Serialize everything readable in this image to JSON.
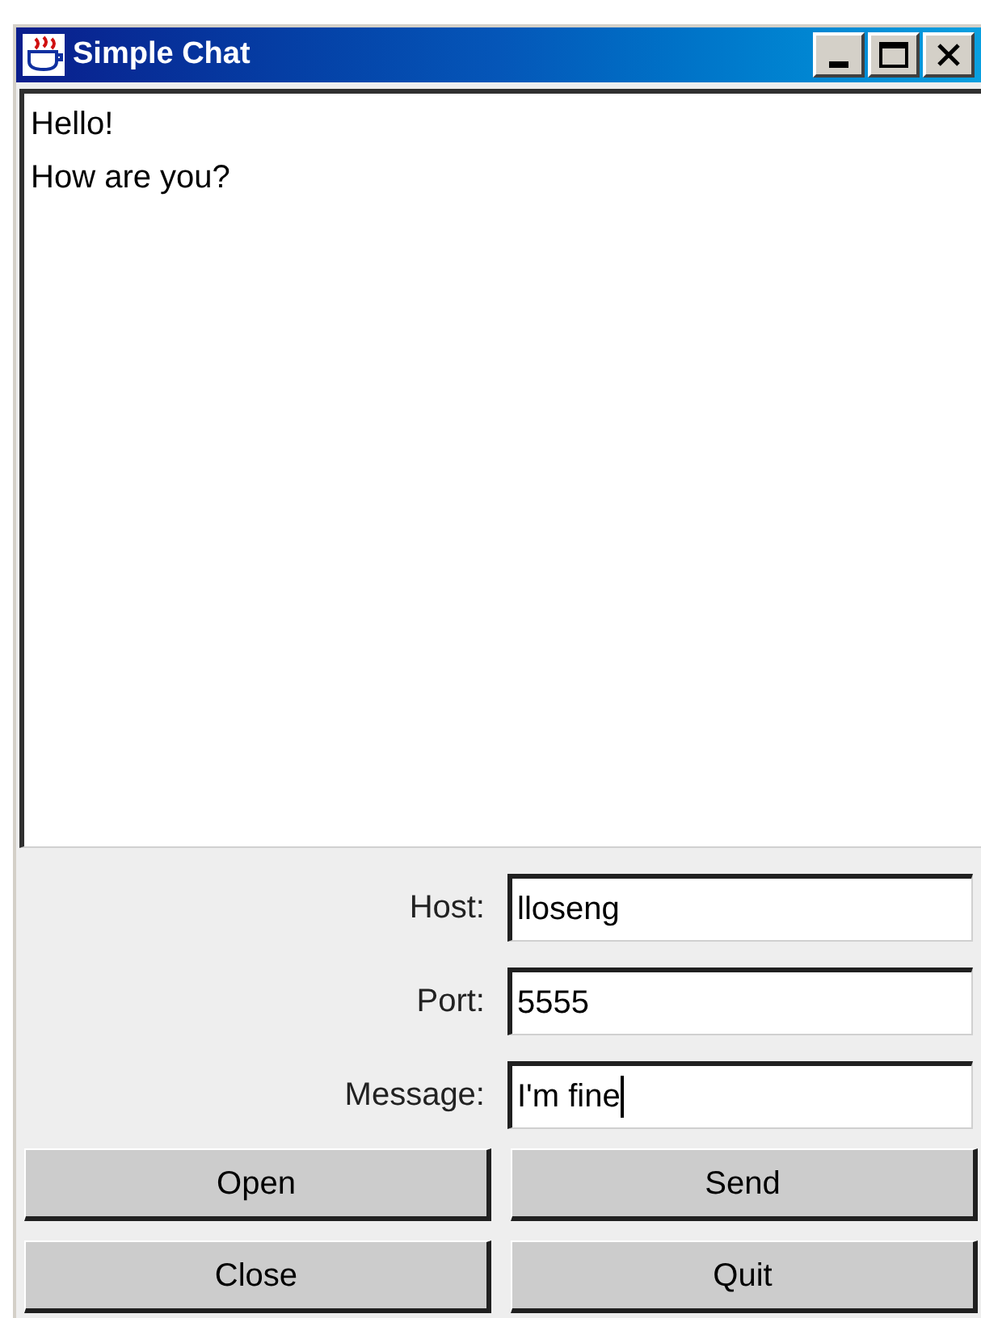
{
  "window": {
    "title": "Simple Chat"
  },
  "messages": [
    "Hello!",
    "How are you?"
  ],
  "fields": [
    {
      "label": "Host:",
      "value": "lloseng",
      "focused": false
    },
    {
      "label": "Port:",
      "value": "5555",
      "focused": false
    },
    {
      "label": "Message:",
      "value": "I'm fine",
      "focused": true
    }
  ],
  "buttons": [
    "Open",
    "Send",
    "Close",
    "Quit"
  ]
}
